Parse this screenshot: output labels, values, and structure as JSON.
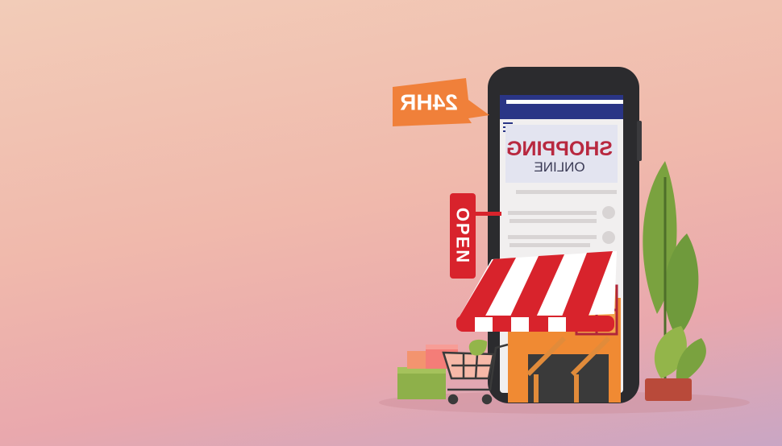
{
  "sign_24hr": "24HR",
  "open_sign": "OPEN",
  "screen_title": "SHOPPING",
  "screen_subtitle": "ONLINE",
  "colors": {
    "awning_red": "#d8232c",
    "sign_orange": "#f0803a",
    "phone_body": "#2b2b2e",
    "screen_header": "#2a3586",
    "plant_green": "#6f9a3c"
  }
}
